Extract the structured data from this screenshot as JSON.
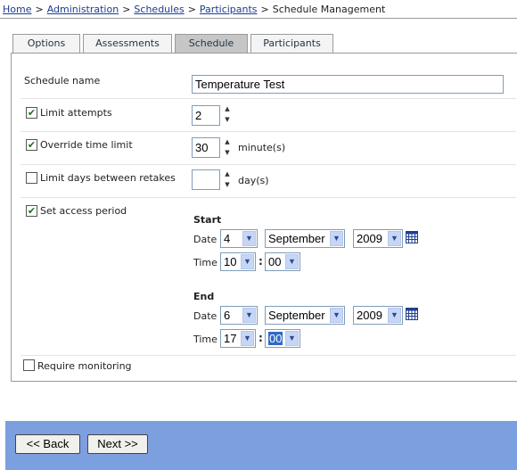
{
  "breadcrumb": {
    "links": [
      "Home",
      "Administration",
      "Schedules",
      "Participants"
    ],
    "separator": ">",
    "current": "Schedule Management"
  },
  "tabs": [
    {
      "label": "Options",
      "active": false
    },
    {
      "label": "Assessments",
      "active": false
    },
    {
      "label": "Schedule",
      "active": true
    },
    {
      "label": "Participants",
      "active": false
    }
  ],
  "form": {
    "schedule_name": {
      "label": "Schedule name",
      "value": "Temperature Test"
    },
    "limit_attempts": {
      "label": "Limit attempts",
      "checked": true,
      "value": "2"
    },
    "override_time_limit": {
      "label": "Override time limit",
      "checked": true,
      "value": "30",
      "unit": "minute(s)"
    },
    "limit_days": {
      "label": "Limit days between retakes",
      "checked": false,
      "value": "",
      "unit": "day(s)"
    },
    "access_period": {
      "label": "Set access period",
      "checked": true,
      "start": {
        "heading": "Start",
        "date_label": "Date",
        "day": "4",
        "month": "September",
        "year": "2009",
        "time_label": "Time",
        "hour": "10",
        "minute": "00"
      },
      "end": {
        "heading": "End",
        "date_label": "Date",
        "day": "6",
        "month": "September",
        "year": "2009",
        "time_label": "Time",
        "hour": "17",
        "minute": "00"
      },
      "time_separator": ":"
    },
    "require_monitoring": {
      "label": "Require monitoring",
      "checked": false
    }
  },
  "icons": {
    "check": "✔",
    "arrow_down": "▼",
    "spin_up": "▲",
    "spin_down": "▼",
    "calendar": "calendar-icon"
  },
  "buttons": {
    "back": "<< Back",
    "next": "Next >>"
  },
  "colors": {
    "footer": "#7c9fdf",
    "link": "#1a3d8f",
    "dropdown_arrow_bg": "#c7d6f4",
    "active_tab": "#c6c6c6"
  }
}
